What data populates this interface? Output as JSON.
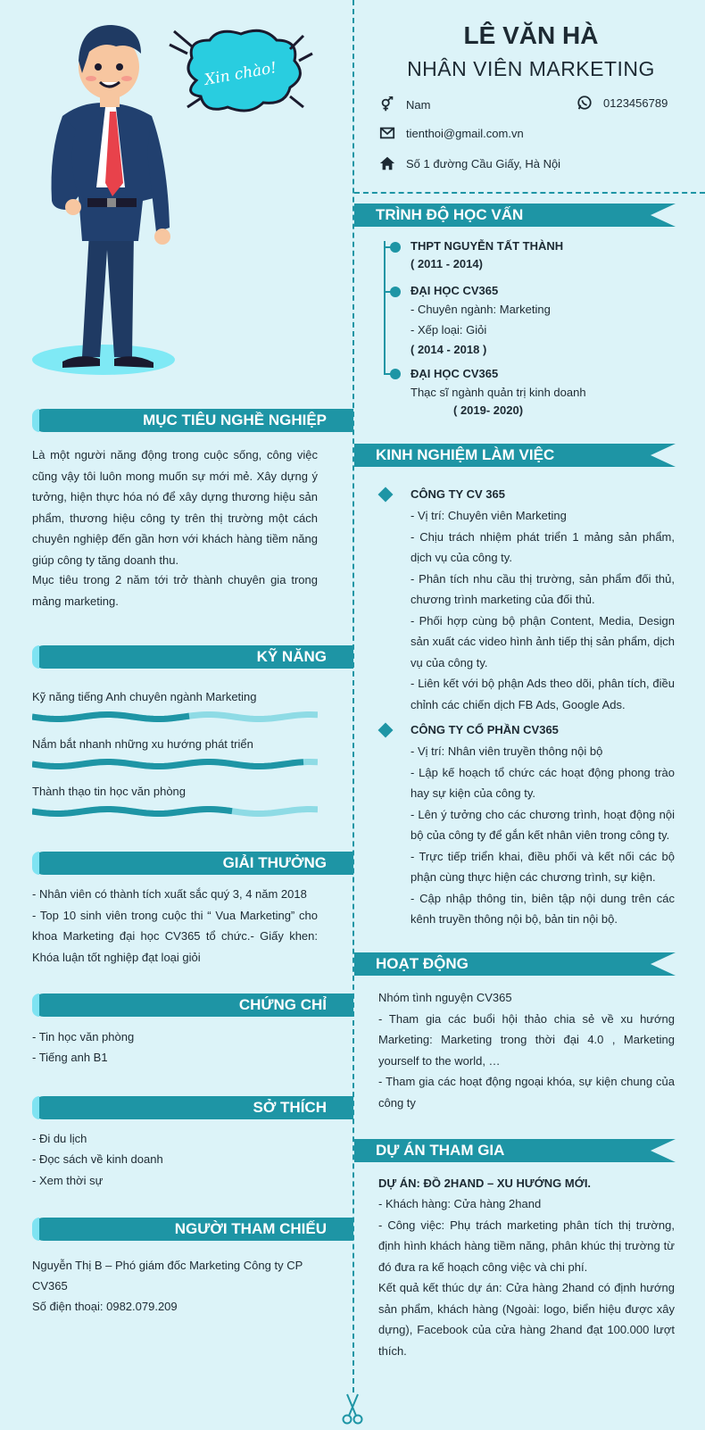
{
  "header": {
    "name": "LÊ VĂN HÀ",
    "role": "NHÂN VIÊN MARKETING",
    "greeting": "Xin chào!",
    "gender": "Nam",
    "phone": "0123456789",
    "email": "tienthoi@gmail.com.vn",
    "address": "Số 1 đường Cầu Giấy, Hà Nội"
  },
  "education": {
    "title": "TRÌNH ĐỘ HỌC VẤN",
    "items": [
      {
        "school": "THPT NGUYỄN TẤT THÀNH",
        "lines": [],
        "years": "( 2011 - 2014)"
      },
      {
        "school": "ĐẠI HỌC CV365",
        "lines": [
          "- Chuyên ngành: Marketing",
          "- Xếp loại: Giỏi"
        ],
        "years": "( 2014 - 2018 )"
      },
      {
        "school": "ĐẠI HỌC CV365",
        "lines": [
          "Thạc sĩ ngành quản trị kinh doanh"
        ],
        "years": "( 2019- 2020)"
      }
    ]
  },
  "objective": {
    "title": "MỤC TIÊU NGHỀ NGHIỆP",
    "p1": "Là một người năng động trong cuộc sống, công việc cũng vậy tôi luôn mong muốn sự mới mẻ. Xây dựng ý tưởng, hiện thực hóa nó để xây dựng thương hiệu sản phẩm, thương hiệu công ty trên thị trường một cách chuyên nghiệp đến gần hơn với khách hàng tiềm năng giúp công ty tăng doanh thu.",
    "p2": "Mục tiêu trong 2 năm tới trở thành chuyên gia trong mảng marketing."
  },
  "skills": {
    "title": "KỸ NĂNG",
    "items": [
      {
        "label": "Kỹ năng tiếng Anh chuyên ngành Marketing",
        "level": 0.55
      },
      {
        "label": "Nắm bắt nhanh những xu hướng phát triển",
        "level": 0.95
      },
      {
        "label": "Thành thạo tin học văn phòng",
        "level": 0.7
      }
    ]
  },
  "awards": {
    "title": "GIẢI THƯỞNG",
    "text": "- Nhân viên có thành tích xuất sắc quý 3, 4 năm 2018\n- Top 10 sinh viên trong cuộc thi “ Vua Marketing” cho khoa Marketing đại học CV365 tổ chức.- Giấy khen: Khóa luận tốt nghiệp đạt loại giỏi"
  },
  "certificates": {
    "title": "CHỨNG CHỈ",
    "items": [
      "- Tin học văn phòng",
      "- Tiếng anh B1"
    ]
  },
  "hobbies": {
    "title": "SỞ THÍCH",
    "items": [
      "- Đi du lịch",
      "- Đọc sách về kinh doanh",
      "- Xem thời sự"
    ]
  },
  "references": {
    "title": "NGƯỜI THAM CHIẾU",
    "line1": "Nguyễn Thị B  – Phó giám đốc Marketing Công ty CP",
    "line2": "CV365",
    "line3": "Số điện thoại: 0982.079.209"
  },
  "experience": {
    "title": "KINH NGHIỆM LÀM VIỆC",
    "companies": [
      {
        "name": "CÔNG TY CV 365",
        "text": "- Vị trí: Chuyên viên Marketing\n- Chịu trách nhiệm phát triển 1 mảng sản phẩm, dịch vụ của công ty.\n- Phân tích nhu cầu thị trường, sản phẩm đối thủ, chương trình marketing của đối thủ.\n- Phối hợp cùng bộ phận Content, Media, Design sản xuất các video hình ảnh tiếp thị sản phẩm, dịch vụ của công ty.\n- Liên kết với bộ phận Ads theo dõi, phân tích, điều chỉnh các chiến dịch FB Ads, Google Ads."
      },
      {
        "name": "CÔNG TY CỔ PHẦN CV365",
        "text": "- Vị trí: Nhân viên truyền thông nội bộ\n- Lập kế hoạch tổ chức các hoạt động phong trào hay sự kiện của công ty.\n- Lên ý tưởng cho các chương trình, hoạt động nội bộ của công ty để gắn kết nhân viên trong công ty.\n- Trực tiếp triển khai, điều phối và kết nối các bộ phận cùng thực hiện các chương trình, sự kiện.\n- Cập nhập thông tin, biên tập nội dung trên các kênh truyền thông nội bộ, bản tin nội bộ."
      }
    ]
  },
  "activities": {
    "title": "HOẠT ĐỘNG",
    "text": "Nhóm tình nguyện CV365\n- Tham gia các buổi hội thảo chia sẻ về xu hướng Marketing: Marketing trong thời đại 4.0 , Marketing yourself to the world, …\n- Tham gia các hoạt động ngoại khóa, sự kiện chung của công ty"
  },
  "projects": {
    "title": "DỰ ÁN THAM GIA",
    "name": "DỰ ÁN: ĐỒ 2HAND – XU HƯỚNG MỚI.",
    "text": "- Khách hàng: Cửa hàng 2hand\n- Công việc: Phụ trách marketing phân tích thị trường, định hình khách hàng tiềm năng, phân khúc thị trường từ đó đưa ra kế hoạch công việc và chi phí.\nKết quả kết thúc dự án: Cửa hàng 2hand có định hướng sản phẩm, khách hàng (Ngoài: logo, biển hiệu được xây dựng), Facebook của cửa hàng 2hand đạt 100.000 lượt thích."
  },
  "colors": {
    "accent": "#1e95a5",
    "background": "#dcf3f8",
    "light_accent": "#7fe3f2"
  }
}
